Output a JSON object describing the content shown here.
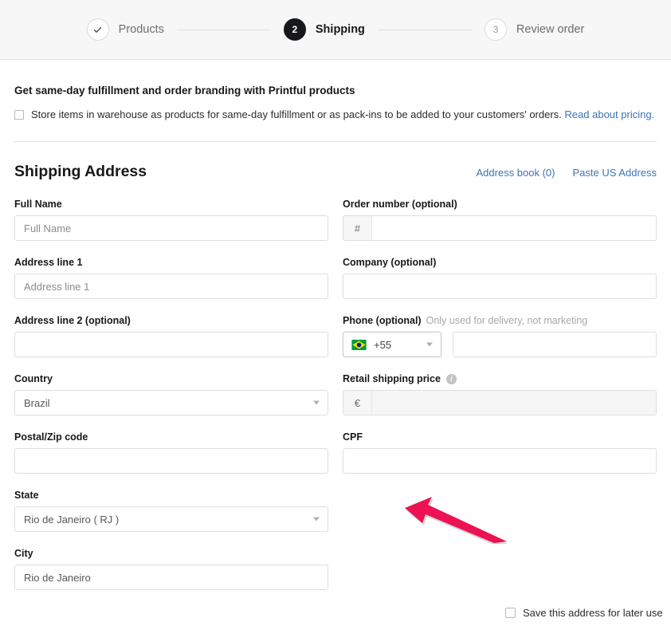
{
  "stepper": {
    "steps": [
      {
        "marker": "check-icon",
        "label": "Products",
        "state": "done"
      },
      {
        "marker": "2",
        "label": "Shipping",
        "state": "current"
      },
      {
        "marker": "3",
        "label": "Review order",
        "state": "upcoming"
      }
    ]
  },
  "promo": {
    "title": "Get same-day fulfillment and order branding with Printful products",
    "checkbox_text": "Store items in warehouse as products for same-day fulfillment or as pack-ins to be added to your customers' orders.",
    "link_label": "Read about pricing.",
    "checked": false
  },
  "section": {
    "title": "Shipping Address",
    "address_book_label": "Address book (0)",
    "paste_us_label": "Paste US Address"
  },
  "fields": {
    "full_name": {
      "label": "Full Name",
      "placeholder": "Full Name",
      "value": ""
    },
    "address1": {
      "label": "Address line 1",
      "placeholder": "Address line 1",
      "value": ""
    },
    "address2": {
      "label": "Address line 2 (optional)",
      "placeholder": "",
      "value": ""
    },
    "country": {
      "label": "Country",
      "value": "Brazil"
    },
    "postal": {
      "label": "Postal/Zip code",
      "placeholder": "",
      "value": ""
    },
    "state": {
      "label": "State",
      "value": "Rio de Janeiro ( RJ )"
    },
    "city": {
      "label": "City",
      "placeholder": "",
      "value": "Rio de Janeiro"
    },
    "order_number": {
      "label": "Order number (optional)",
      "prefix": "#",
      "placeholder": "",
      "value": ""
    },
    "company": {
      "label": "Company (optional)",
      "placeholder": "",
      "value": ""
    },
    "phone": {
      "label": "Phone (optional)",
      "hint": "Only used for delivery, not marketing",
      "country_code": "+55",
      "flag": "brazil-flag",
      "placeholder": "",
      "value": ""
    },
    "retail_shipping_price": {
      "label": "Retail shipping price",
      "info": "i",
      "prefix": "€",
      "placeholder": "",
      "value": "",
      "disabled": true
    },
    "cpf": {
      "label": "CPF",
      "placeholder": "",
      "value": ""
    }
  },
  "save_address": {
    "label": "Save this address for later use",
    "checked": false
  },
  "annotation": {
    "type": "arrow",
    "color": "#ED1254",
    "points_to": "cpf-input"
  },
  "colors": {
    "link": "#3a74b8",
    "header_bg": "#f7f7f7",
    "current_step": "#17181a",
    "arrow": "#ED1254"
  }
}
